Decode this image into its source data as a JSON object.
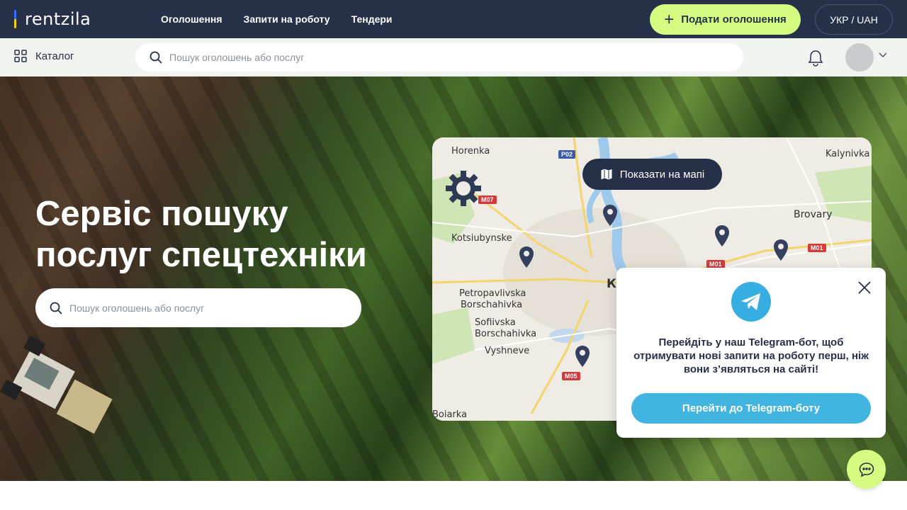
{
  "brand": {
    "logo_text": "rentzila"
  },
  "nav": {
    "items": [
      {
        "label": "Оголошення"
      },
      {
        "label": "Запити на роботу"
      },
      {
        "label": "Тендери"
      }
    ]
  },
  "header": {
    "post_button": "Подати оголошення",
    "language": "УКР / UAH"
  },
  "subheader": {
    "catalog_label": "Каталог",
    "search_placeholder": "Пошук оголошень або послуг"
  },
  "hero": {
    "title_line1": "Сервіс пошуку",
    "title_line2": "послуг спецтехніки",
    "search_placeholder": "Пошук оголошень або послуг"
  },
  "map": {
    "button_label": "Показати на мапі",
    "places": [
      "Horenka",
      "Kalynivka",
      "Kotsiubynske",
      "Brovary",
      "Petropavlivska",
      "Borschahivka",
      "Sofiivska",
      "Borschahivka",
      "Vyshneve",
      "Ку",
      "Boiarka"
    ],
    "roads": [
      "P02",
      "M07",
      "M01",
      "M01",
      "M05"
    ]
  },
  "telegram_popup": {
    "message": "Перейдіть у наш Telegram-бот, щоб отримувати нові запити на роботу перш, ніж вони з’являться на сайті!",
    "button_label": "Перейти до Telegram-боту"
  },
  "colors": {
    "primary": "#273049",
    "accent": "#d3fc81",
    "telegram": "#42b4e2"
  },
  "icons": {
    "catalog": "grid-icon",
    "search": "search-icon",
    "bell": "bell-icon",
    "map": "map-icon",
    "pin": "map-pin-icon",
    "close": "close-icon",
    "chat": "chat-icon"
  }
}
